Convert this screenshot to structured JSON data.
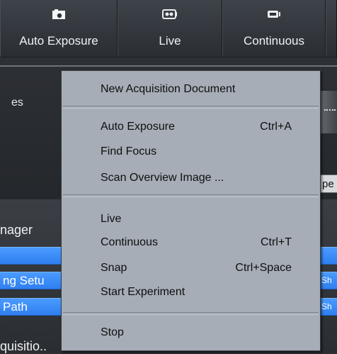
{
  "toolbar": {
    "auto_exposure_label": "Auto Exposure",
    "live_label": "Live",
    "continuous_label": "Continuous"
  },
  "background": {
    "panel_fragment_text": "es",
    "side_button_fragment": "pe",
    "manager_fragment": "nager",
    "row_setup_fragment": "ng Setu",
    "row_path_fragment": "Path",
    "right_fragment_1": "Sh",
    "right_fragment_2": "Sh",
    "acquisition_fragment": "quisitio.."
  },
  "context_menu": {
    "new_document": "New Acquisition Document",
    "auto_exposure": {
      "label": "Auto Exposure",
      "shortcut": "Ctrl+A"
    },
    "find_focus": "Find Focus",
    "scan_overview": "Scan Overview Image ...",
    "live": "Live",
    "continuous": {
      "label": "Continuous",
      "shortcut": "Ctrl+T"
    },
    "snap": {
      "label": "Snap",
      "shortcut": "Ctrl+Space"
    },
    "start_experiment": "Start Experiment",
    "stop": "Stop"
  },
  "colors": {
    "menu_background": "#a6adb6",
    "selection_blue": "#3a8dfa",
    "toolbar_dark": "#2f3338"
  },
  "icons": [
    "camera-icon",
    "live-camera-icon",
    "continuous-camera-icon"
  ]
}
